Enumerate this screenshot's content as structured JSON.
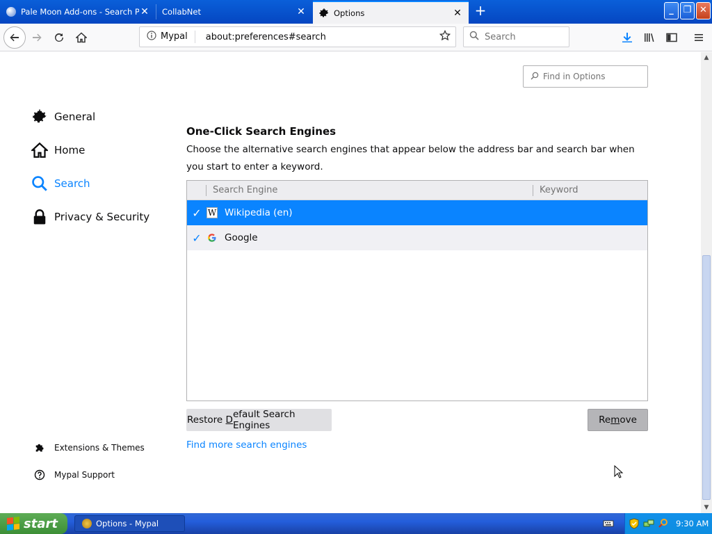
{
  "browser": {
    "tabs": [
      {
        "title": "Pale Moon Add-ons - Search Plugins",
        "active": false
      },
      {
        "title": "CollabNet",
        "active": false
      },
      {
        "title": "Options",
        "active": true
      }
    ],
    "identity_label": "Mypal",
    "url": "about:preferences#search",
    "search_placeholder": "Search"
  },
  "sidebar": {
    "categories": [
      {
        "label": "General",
        "icon": "gear-icon"
      },
      {
        "label": "Home",
        "icon": "home-icon"
      },
      {
        "label": "Search",
        "icon": "search-icon",
        "selected": true
      },
      {
        "label": "Privacy & Security",
        "icon": "lock-icon"
      }
    ],
    "footer_links": [
      {
        "label": "Extensions & Themes",
        "icon": "puzzle-icon"
      },
      {
        "label": "Mypal Support",
        "icon": "help-icon"
      }
    ]
  },
  "find_in_options_placeholder": "Find in Options",
  "section": {
    "title": "One-Click Search Engines",
    "description": "Choose the alternative search engines that appear below the address bar and search bar when you start to enter a keyword."
  },
  "table": {
    "columns": [
      "Search Engine",
      "Keyword"
    ],
    "rows": [
      {
        "name": "Wikipedia (en)",
        "keyword": "",
        "checked": true,
        "selected": true,
        "icon": "wikipedia-icon"
      },
      {
        "name": "Google",
        "keyword": "",
        "checked": true,
        "selected": false,
        "icon": "google-icon"
      }
    ]
  },
  "buttons": {
    "restore_prefix": "Restore ",
    "restore_access_key": "D",
    "restore_suffix": "efault Search Engines",
    "remove_prefix": "Re",
    "remove_access_key": "m",
    "remove_suffix": "ove"
  },
  "find_more_link": "Find more search engines",
  "taskbar": {
    "start_label": "start",
    "task_item": "Options - Mypal",
    "clock": "9:30 AM"
  },
  "colors": {
    "accent": "#0a84ff",
    "selected_row": "#0a84ff",
    "taskbar": "#245edb"
  }
}
